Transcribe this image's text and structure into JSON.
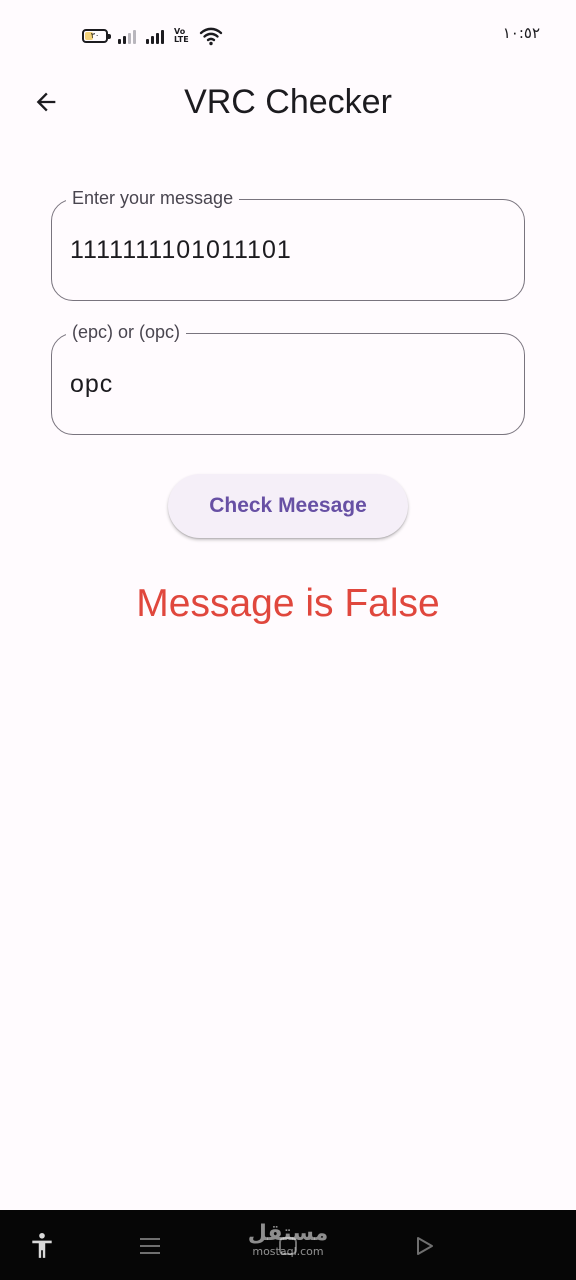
{
  "status_bar": {
    "battery_level": "٣٠",
    "network_label_top": "Vo",
    "network_label_bottom": "LTE",
    "time": "١٠:٥٢"
  },
  "app_bar": {
    "title": "VRC Checker",
    "back_icon": "arrow-back-icon"
  },
  "form": {
    "message_field": {
      "label": "Enter your message",
      "value": "1111111101011101"
    },
    "parity_field": {
      "label": "(epc) or (opc)",
      "value": "opc"
    },
    "check_button_label": "Check Meesage"
  },
  "result": {
    "text": "Message is False",
    "color": "#e0473d"
  },
  "bottom_bar": {
    "icons": [
      "accessibility-icon",
      "menu-icon",
      "home-icon",
      "play-icon"
    ],
    "watermark_arabic": "مستقل",
    "watermark_latin": "mostaql.com"
  },
  "colors": {
    "background": "#fffbfe",
    "accent": "#6750a4",
    "outline": "#79747e",
    "error": "#e0473d"
  }
}
